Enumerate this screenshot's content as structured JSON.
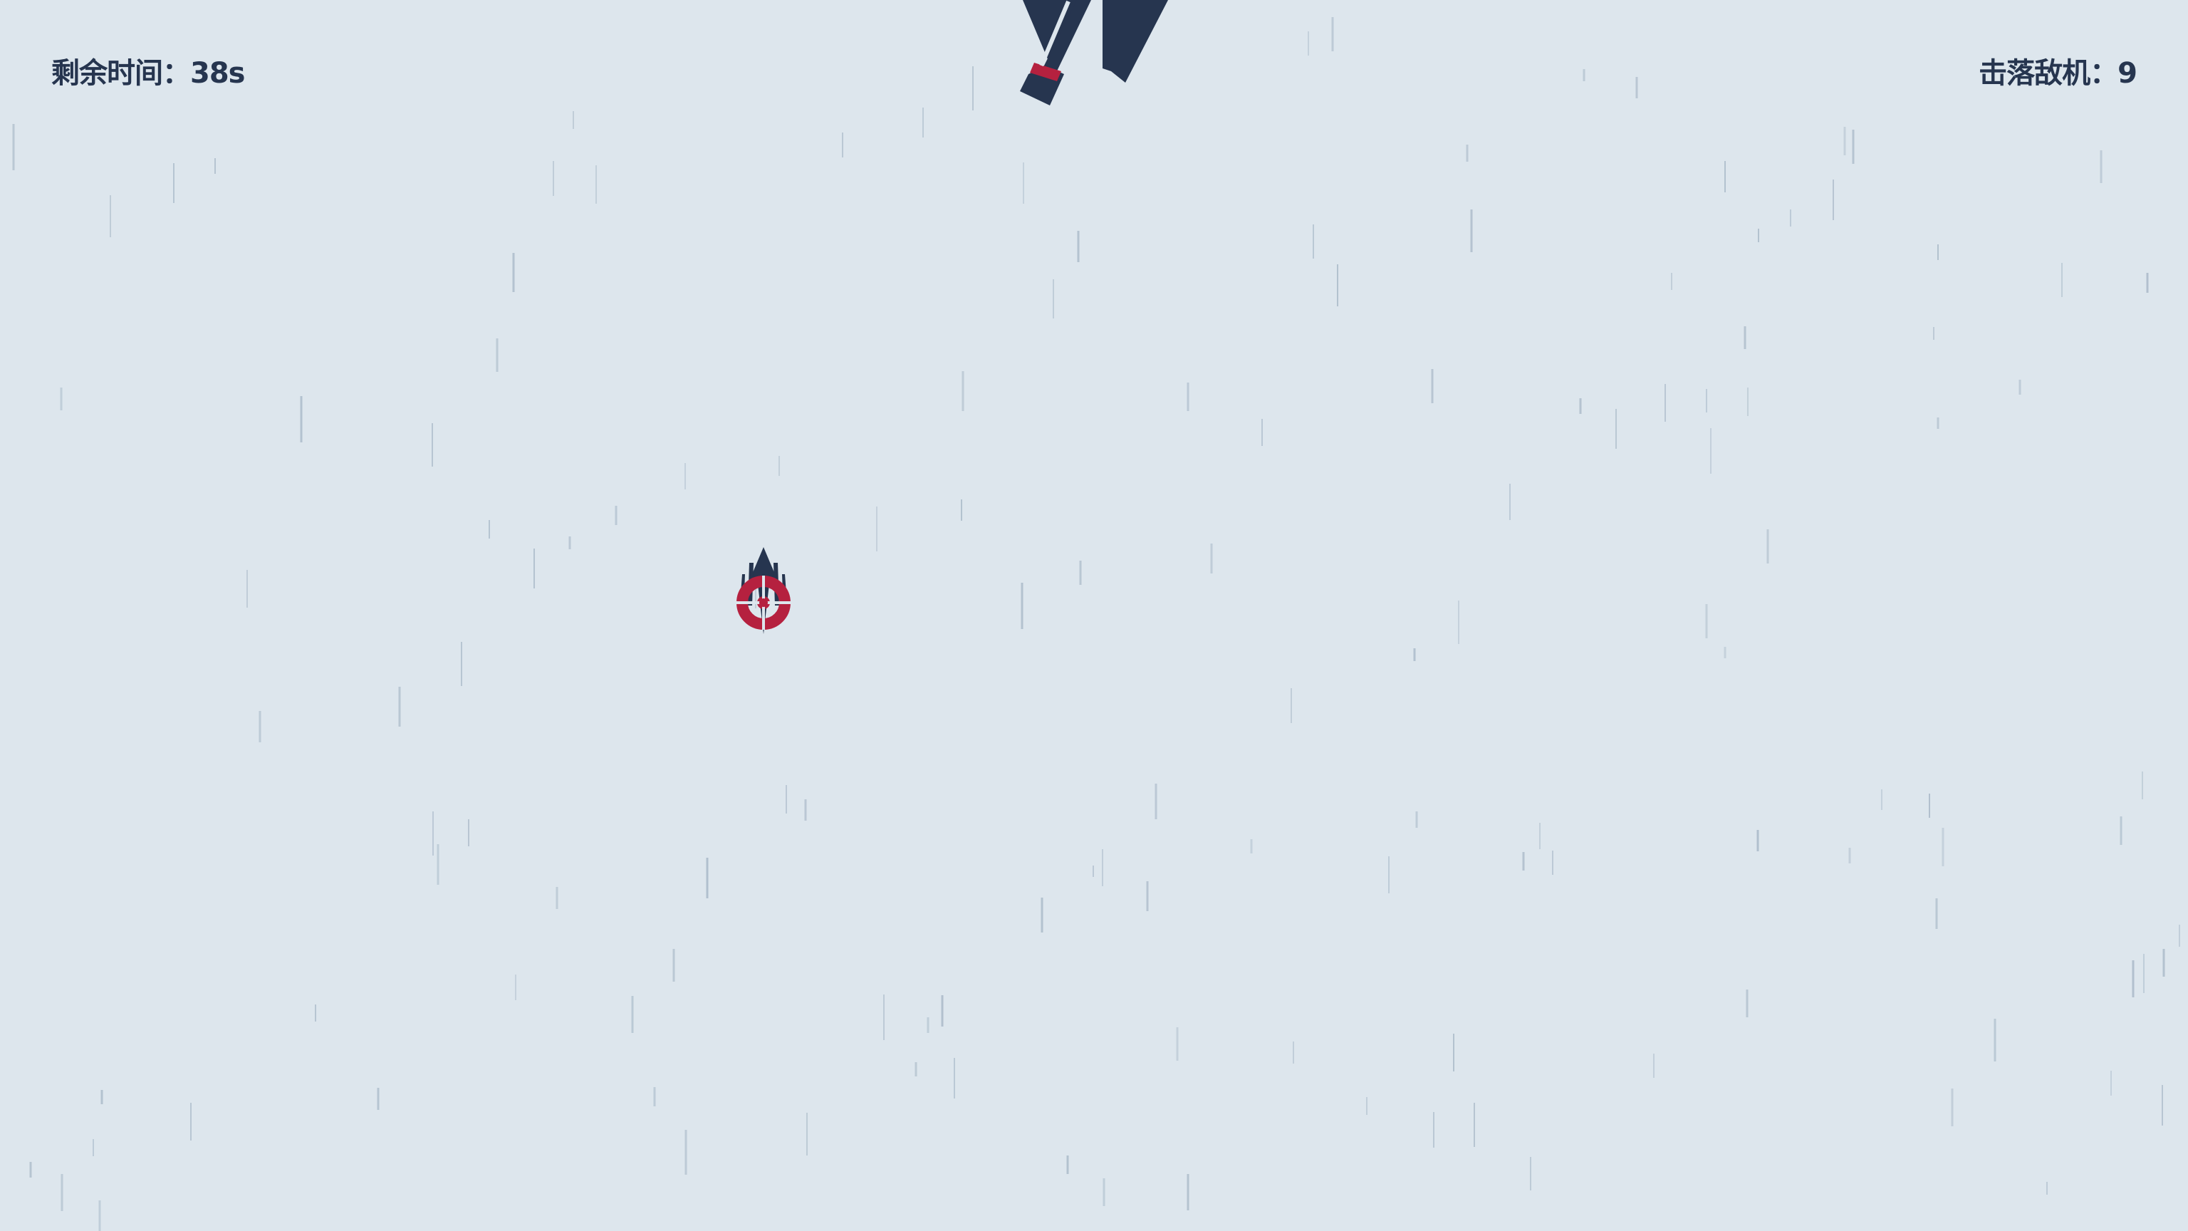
{
  "hud": {
    "time_label": "剩余时间：",
    "time_value": "38s",
    "kills_label": "击落敌机：",
    "kills_value": "9"
  },
  "colors": {
    "background": "#dde6ed",
    "ink": "#26354f",
    "accent": "#b5213f",
    "rain": "#a9b9c8"
  },
  "entities": {
    "player": "player-jet-with-target-reticle",
    "enemy": "enemy-jet-partially-offscreen"
  }
}
